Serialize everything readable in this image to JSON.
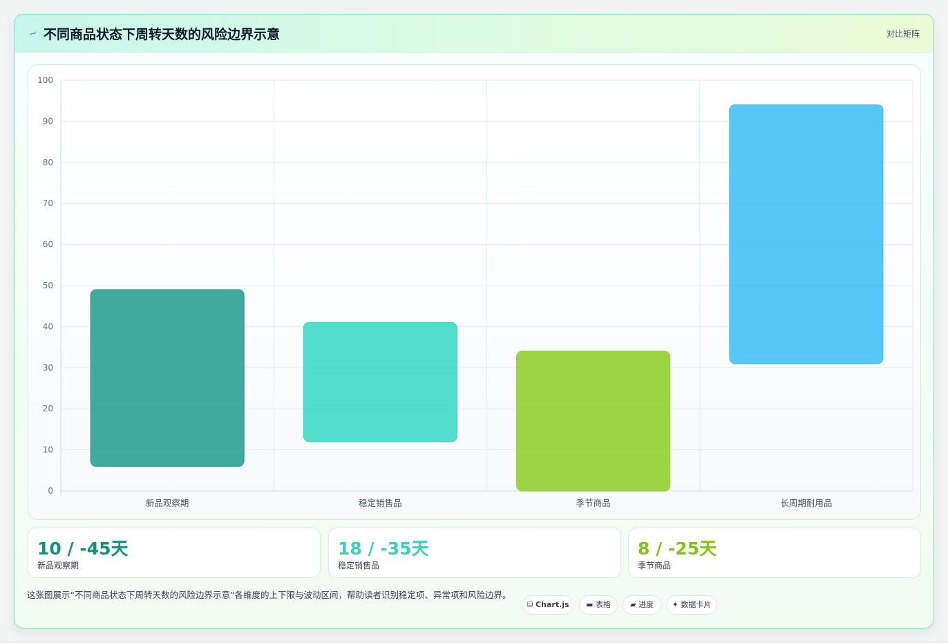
{
  "header": {
    "title": "不同商品状态下周转天数的风险边界示意",
    "action_label": "对比矩阵",
    "icon": "lightning-icon"
  },
  "chart_data": {
    "type": "bar",
    "subtype": "floating-range",
    "categories": [
      "新品观察期",
      "稳定销售品",
      "季节商品",
      "长周期耐用品"
    ],
    "series": [
      {
        "low": 6,
        "high": 49,
        "color": "#279e8f"
      },
      {
        "low": 12,
        "high": 41,
        "color": "#3ad8c6"
      },
      {
        "low": 0,
        "high": 34,
        "color": "#8fce2b"
      },
      {
        "low": 31,
        "high": 94,
        "color": "#3fbff5"
      }
    ],
    "ylim": [
      0,
      100
    ],
    "yticks": [
      0,
      10,
      20,
      30,
      40,
      50,
      60,
      70,
      80,
      90,
      100
    ],
    "grid": true,
    "legend": "none"
  },
  "stats": [
    {
      "value": "10 / -45天",
      "label": "新品观察期",
      "color": "#12917e"
    },
    {
      "value": "18 / -35天",
      "label": "稳定销售品",
      "color": "#3ccfc0"
    },
    {
      "value": "8 / -25天",
      "label": "季节商品",
      "color": "#84c41a"
    }
  ],
  "footer": {
    "text": "这张图展示“不同商品状态下周转天数的风险边界示意”各维度的上下限与波动区间，帮助读者识别稳定项、异常项和风险边界。"
  },
  "tags": [
    {
      "icon": "database-icon",
      "label": "Chart.js",
      "bold": true
    },
    {
      "icon": "table-icon",
      "label": "表格",
      "bold": false
    },
    {
      "icon": "progress-icon",
      "label": "进度",
      "bold": false
    },
    {
      "icon": "sparkle-icon",
      "label": "数据卡片",
      "bold": false
    }
  ]
}
